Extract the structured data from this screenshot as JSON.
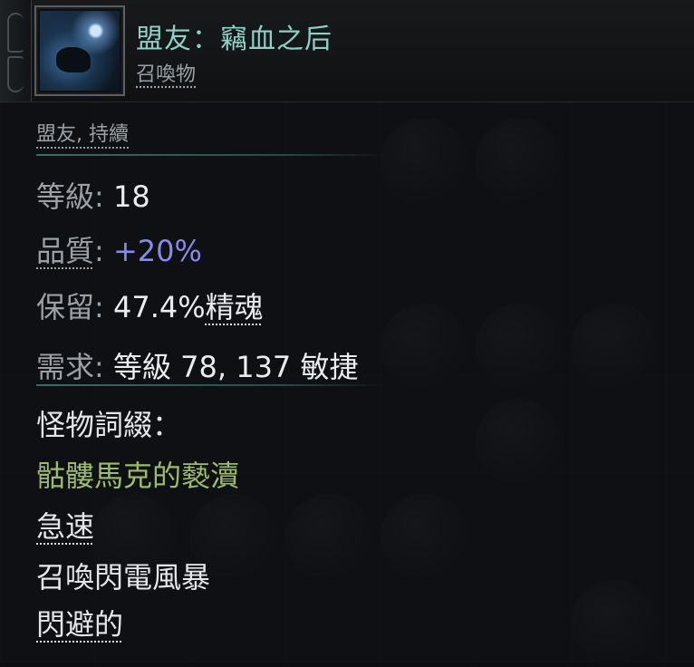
{
  "item": {
    "name": "盟友：竊血之后",
    "type": "召喚物",
    "gem_icon": "summon-gem-icon"
  },
  "tags": "盟友, 持續",
  "stats": {
    "level_label": "等級",
    "level_value": "18",
    "quality_label": "品質",
    "quality_value": "+20%",
    "reservation_label": "保留",
    "reservation_value": "47.4%",
    "reservation_resource": "精魂",
    "requirement_label": "需求",
    "requirement_value": "等級 78, 137 敏捷"
  },
  "modifiers": {
    "header": "怪物詞綴：",
    "items": [
      "骷髏馬克的褻瀆",
      "急速",
      "召喚閃電風暴",
      "閃避的"
    ]
  },
  "colors": {
    "name": "#8ed0c6",
    "quality": "#8a88e8",
    "green_mod": "#9dbb6b",
    "divider": "#3f6b66"
  }
}
